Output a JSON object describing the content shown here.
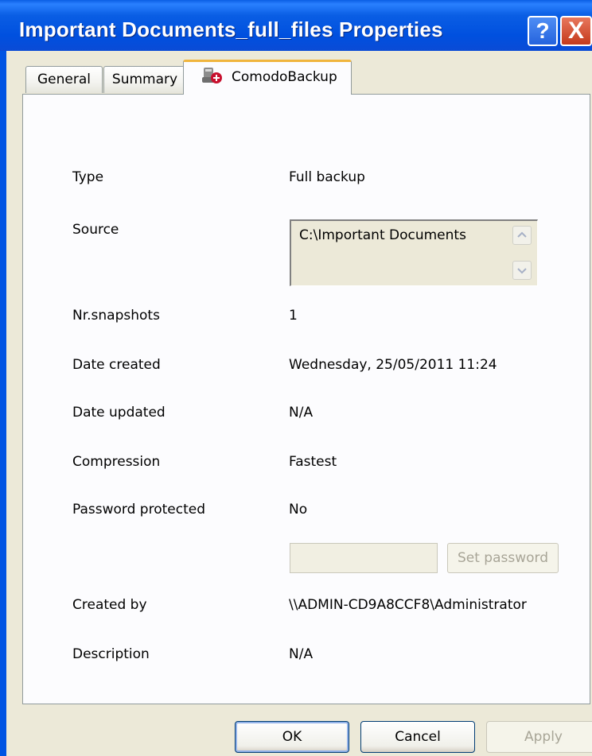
{
  "window": {
    "title": "Important Documents_full_files Properties",
    "help_label": "?",
    "close_label": "X"
  },
  "tabs": [
    {
      "label": "General"
    },
    {
      "label": "Summary"
    },
    {
      "label": "ComodoBackup",
      "icon": "comodo-backup-icon",
      "selected": true
    }
  ],
  "properties": {
    "type_label": "Type",
    "type_value": "Full backup",
    "source_label": "Source",
    "source_value": "C:\\Important Documents",
    "snapshots_label": "Nr.snapshots",
    "snapshots_value": "1",
    "date_created_label": "Date created",
    "date_created_value": "Wednesday, 25/05/2011 11:24",
    "date_updated_label": "Date updated",
    "date_updated_value": "N/A",
    "compression_label": "Compression",
    "compression_value": "Fastest",
    "password_label": "Password protected",
    "password_value": "No",
    "password_input_value": "",
    "set_password_label": "Set password",
    "created_by_label": "Created by",
    "created_by_value": "\\\\ADMIN-CD9A8CCF8\\Administrator",
    "description_label": "Description",
    "description_value": "N/A"
  },
  "buttons": {
    "ok": "OK",
    "cancel": "Cancel",
    "apply": "Apply"
  },
  "colors": {
    "titlebar": "#0054e3",
    "dialog_bg": "#ece9d8",
    "panel_bg": "#fcfcfe",
    "active_tab_accent": "#f0b53d"
  }
}
